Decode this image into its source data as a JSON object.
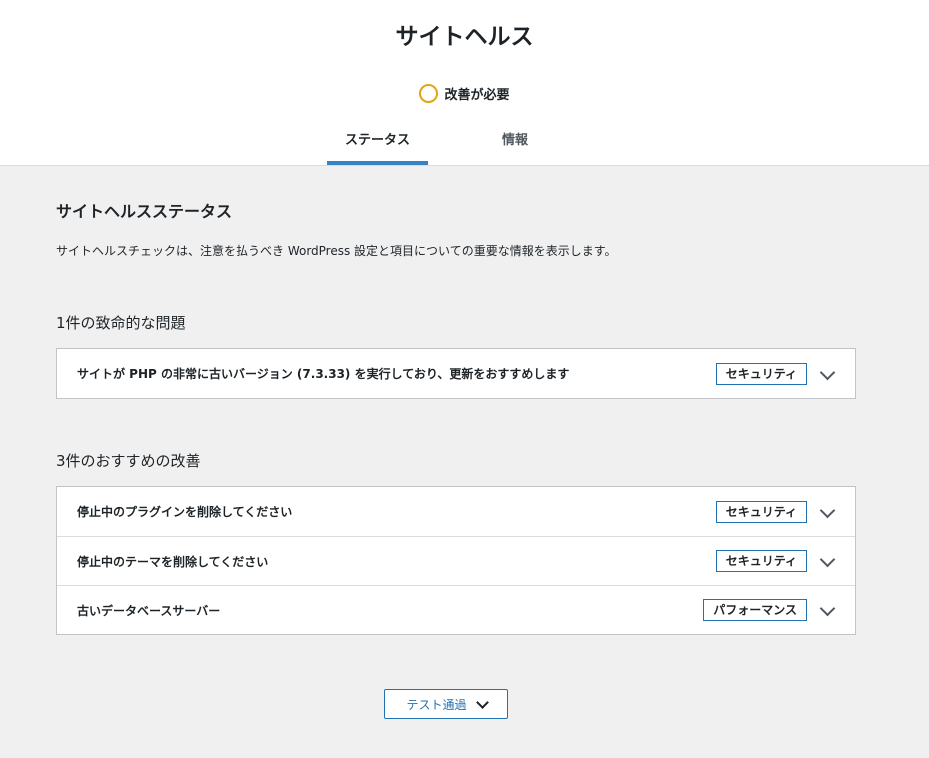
{
  "header": {
    "title": "サイトヘルス",
    "status_label": "改善が必要",
    "tabs": [
      {
        "label": "ステータス",
        "active": true
      },
      {
        "label": "情報",
        "active": false
      }
    ]
  },
  "status_section": {
    "title": "サイトヘルスステータス",
    "description": "サイトヘルスチェックは、注意を払うべき WordPress 設定と項目についての重要な情報を表示します。"
  },
  "critical": {
    "title": "1件の致命的な問題",
    "items": [
      {
        "label": "サイトが PHP の非常に古いバージョン (7.3.33) を実行しており、更新をおすすめします",
        "badge": "セキュリティ"
      }
    ]
  },
  "recommended": {
    "title": "3件のおすすめの改善",
    "items": [
      {
        "label": "停止中のプラグインを削除してください",
        "badge": "セキュリティ"
      },
      {
        "label": "停止中のテーマを削除してください",
        "badge": "セキュリティ"
      },
      {
        "label": "古いデータベースサーバー",
        "badge": "パフォーマンス"
      }
    ]
  },
  "passed_button": {
    "label": "テスト通過"
  },
  "colors": {
    "accent": "#2271b1",
    "status_circle": "#dba617",
    "tab_underline": "#3582c4"
  }
}
